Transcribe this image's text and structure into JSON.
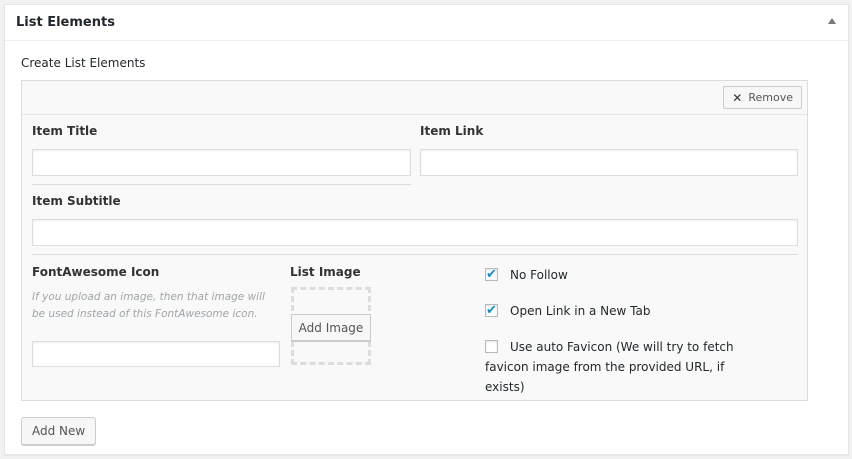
{
  "metabox": {
    "title": "List Elements",
    "section_label": "Create List Elements"
  },
  "item": {
    "remove_label": "Remove",
    "title_label": "Item Title",
    "title_value": "",
    "link_label": "Item Link",
    "link_value": "",
    "subtitle_label": "Item Subtitle",
    "subtitle_value": "",
    "icon_label": "FontAwesome Icon",
    "icon_help": "If you upload an image, then that image will be used instead of this FontAwesome icon.",
    "icon_value": "",
    "image_label": "List Image",
    "add_image_label": "Add Image",
    "checkboxes": [
      {
        "label": "No Follow",
        "checked": true
      },
      {
        "label": "Open Link in a New Tab",
        "checked": true
      },
      {
        "label": "Use auto Favicon (We will try to fetch favicon image from the provided URL, if exists)",
        "checked": false
      }
    ]
  },
  "footer": {
    "add_new_label": "Add New"
  },
  "colors": {
    "accent": "#1e8cbe",
    "panel_bg": "#f9f9f9",
    "border": "#dddddd"
  }
}
